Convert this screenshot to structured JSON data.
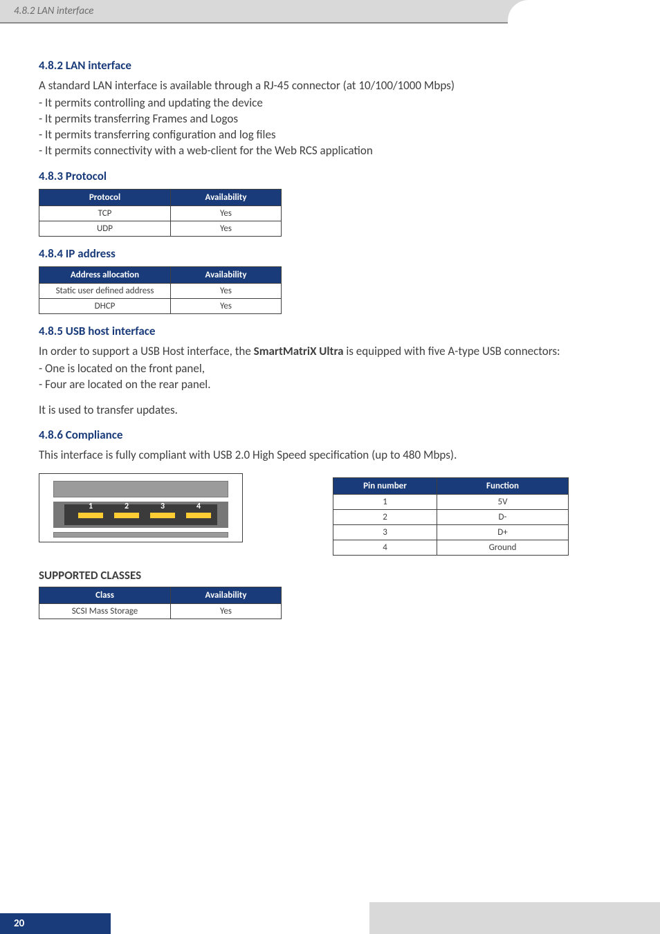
{
  "header": {
    "breadcrumb": "4.8.2 LAN interface"
  },
  "s482": {
    "title": "4.8.2 LAN interface",
    "lead": "A standard LAN interface is available through a RJ-45 connector (at 10/100/1000 Mbps)",
    "b1": "- It permits controlling and updating the device",
    "b2": "- It permits transferring Frames and Logos",
    "b3": "- It permits transferring configuration and log files",
    "b4": "- It permits connectivity with a web-client for the Web RCS application"
  },
  "s483": {
    "title": "4.8.3 Protocol",
    "table": {
      "h1": "Protocol",
      "h2": "Availability",
      "rows": [
        {
          "c1": "TCP",
          "c2": "Yes"
        },
        {
          "c1": "UDP",
          "c2": "Yes"
        }
      ]
    }
  },
  "s484": {
    "title": "4.8.4 IP address",
    "table": {
      "h1": "Address allocation",
      "h2": "Availability",
      "rows": [
        {
          "c1": "Static user defined address",
          "c2": "Yes"
        },
        {
          "c1": "DHCP",
          "c2": "Yes"
        }
      ]
    }
  },
  "s485": {
    "title": "4.8.5 USB host interface",
    "lead_a": "In order to support a USB Host interface, the ",
    "lead_bold": "SmartMatriX Ultra",
    "lead_b": " is equipped with five A-type USB connectors:",
    "b1": "- One is located on the front panel,",
    "b2": "- Four are located on the rear panel.",
    "b3": "It is used to transfer updates."
  },
  "s486": {
    "title": "4.8.6 Compliance",
    "lead": "This interface is fully compliant with USB 2.0 High Speed specification (up to 480 Mbps).",
    "pins": {
      "p1": "1",
      "p2": "2",
      "p3": "3",
      "p4": "4"
    },
    "pinTable": {
      "h1": "Pin number",
      "h2": "Function",
      "rows": [
        {
          "c1": "1",
          "c2": "5V"
        },
        {
          "c1": "2",
          "c2": "D-"
        },
        {
          "c1": "3",
          "c2": "D+"
        },
        {
          "c1": "4",
          "c2": "Ground"
        }
      ]
    }
  },
  "classes": {
    "title": "SUPPORTED CLASSES",
    "table": {
      "h1": "Class",
      "h2": "Availability",
      "rows": [
        {
          "c1": "SCSI Mass Storage",
          "c2": "Yes"
        }
      ]
    }
  },
  "footer": {
    "page": "20"
  }
}
